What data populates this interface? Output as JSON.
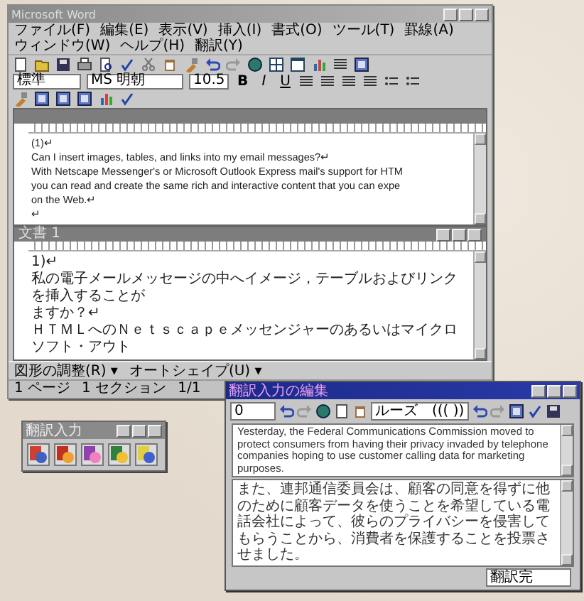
{
  "word_window": {
    "title": "Microsoft Word",
    "menu": [
      "ファイル(F)",
      "編集(E)",
      "表示(V)",
      "挿入(I)",
      "書式(O)",
      "ツール(T)",
      "罫線(A)",
      "ウィンドウ(W)",
      "ヘルプ(H)",
      "翻訳(Y)"
    ],
    "style_box": "標準",
    "font_box": "MS 明朝",
    "size_box": "10.5",
    "format_buttons": [
      "B",
      "I",
      "U"
    ],
    "documents": [
      {
        "lines": [
          "(1)↵",
          "Can I insert images, tables, and links into my email messages?↵",
          "With Netscape Messenger's or Microsoft Outlook Express mail's support for HTM",
          "you can read and create the same rich and interactive content that you can expe",
          "on the Web.↵",
          "↵"
        ]
      },
      {
        "title": "文書 1",
        "lines": [
          "1)↵",
          "私の電子メールメッセージの中へイメージ，テーブルおよびリンクを挿入することが",
          "ますか？↵",
          "ＨＴＭＬへのＮｅｔｓｃａｐｅメッセンジャーのあるいはマイクロソフト・アウト"
        ]
      }
    ],
    "drawing_toolbar": [
      "図形の調整(R) ▾",
      "オートシェイプ(U) ▾"
    ],
    "status_bar": [
      "1 ページ",
      "1 セクション",
      "1/1"
    ]
  },
  "palette": {
    "title": "翻訳入力"
  },
  "dialog": {
    "title": "翻訳入力の編集",
    "number_field": "0",
    "mode_box": "ルーズ　((( ))",
    "source_text": "Yesterday, the Federal Communications Commission moved to protect consumers from having their privacy invaded by telephone companies hoping to use customer calling data for marketing purposes.",
    "translation_text": "また、連邦通信委員会は、顧客の同意を得ずに他のために顧客データを使うことを希望している電話会社によって、彼らのプライバシーを侵害してもらうことから、消費者を保護することを投票させました。",
    "status_field": "翻訳完"
  }
}
